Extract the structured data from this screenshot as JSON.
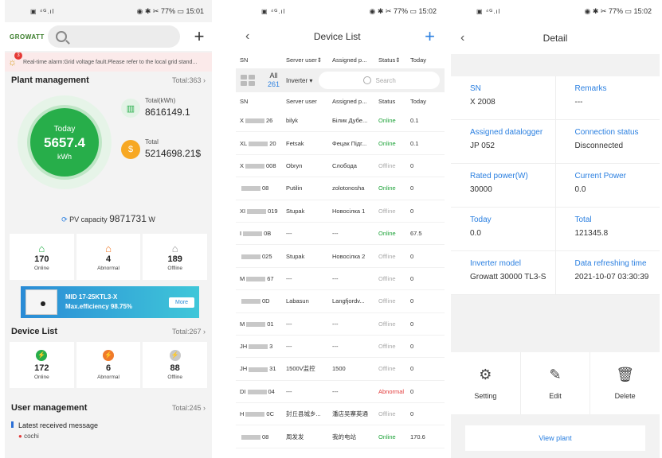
{
  "colors": {
    "accent_blue": "#2a7fe0",
    "online": "#1fa33a",
    "abnormal": "#e23b3b",
    "offline": "#aaaaaa",
    "brand_green": "#27ae4a"
  },
  "status_bar": {
    "left": {
      "icons": "▣ ⁴ᴳ.ıl"
    },
    "p1": {
      "right": "◉ ✱ ✂ 77% ▭ 15:01"
    },
    "p2": {
      "right": "◉ ✱ ✂ 77% ▭ 15:02"
    },
    "p3": {
      "right": "◉ ✱ ✂ 77% ▭ 15:02"
    }
  },
  "home": {
    "logo": "GROWATT",
    "alarm_badge": "3",
    "alarm_text": "Real-time alarm:Grid voltage fault.Please refer to the local grid stand...",
    "plant_management": {
      "title": "Plant management",
      "total": "Total:363"
    },
    "today_label": "Today",
    "today_value": "5657.4",
    "today_unit": "kWh",
    "total_kwh_label": "Total(kWh)",
    "total_kwh_value": "8616149.1",
    "total_money_label": "Total",
    "total_money_value": "5214698.21$",
    "pv_capacity_label": "PV capacity",
    "pv_capacity_value": "9871731",
    "pv_capacity_unit": "W",
    "plant_cards": [
      {
        "value": "170",
        "label": "Online"
      },
      {
        "value": "4",
        "label": "Abnormal"
      },
      {
        "value": "189",
        "label": "Offline"
      }
    ],
    "banner": {
      "line1": "MID 17-25KTL3-X",
      "line2": "Max.efficiency 98.75%",
      "button": "More"
    },
    "device_list": {
      "title": "Device List",
      "total": "Total:267"
    },
    "device_cards": [
      {
        "value": "172",
        "label": "Online"
      },
      {
        "value": "6",
        "label": "Abnormal"
      },
      {
        "value": "88",
        "label": "Offline"
      }
    ],
    "user_management": {
      "title": "User management",
      "total": "Total:245"
    },
    "latest_message": "Latest received message",
    "latest_sender": "cochi"
  },
  "device_list": {
    "title": "Device List",
    "header": [
      "SN",
      "Server user",
      "Assigned p...",
      "Status",
      "Today"
    ],
    "header_sorted": [
      "SN",
      "Server user",
      "Assigned p...",
      "Status",
      "Today"
    ],
    "filter": {
      "all_label": "All",
      "all_count": "261",
      "type": "Inverter",
      "search_placeholder": "Search"
    },
    "rows": [
      {
        "sn_a": "X",
        "sn_b": "26",
        "user": "bilyk",
        "plant": "Білик Дубе...",
        "status": "Online",
        "today": "0.1"
      },
      {
        "sn_a": "XL",
        "sn_b": "20",
        "user": "Fetsak",
        "plant": "Фецак Підг...",
        "status": "Online",
        "today": "0.1"
      },
      {
        "sn_a": "X",
        "sn_b": "008",
        "user": "Obryn",
        "plant": "Слобода",
        "status": "Offline",
        "today": "0"
      },
      {
        "sn_a": "",
        "sn_b": "08",
        "user": "Putilin",
        "plant": "zolotonosha",
        "status": "Online",
        "today": "0"
      },
      {
        "sn_a": "XI",
        "sn_b": "019",
        "user": "Stupak",
        "plant": "Новосілка 1",
        "status": "Offline",
        "today": "0"
      },
      {
        "sn_a": "I",
        "sn_b": "0B",
        "user": "---",
        "plant": "---",
        "status": "Online",
        "today": "67.5"
      },
      {
        "sn_a": "",
        "sn_b": "025",
        "user": "Stupak",
        "plant": "Новосілка 2",
        "status": "Offline",
        "today": "0"
      },
      {
        "sn_a": "M",
        "sn_b": "67",
        "user": "---",
        "plant": "---",
        "status": "Offline",
        "today": "0"
      },
      {
        "sn_a": "",
        "sn_b": "0D",
        "user": "Labasun",
        "plant": "Langfjordv...",
        "status": "Offline",
        "today": "0"
      },
      {
        "sn_a": "M",
        "sn_b": "01",
        "user": "---",
        "plant": "---",
        "status": "Offline",
        "today": "0"
      },
      {
        "sn_a": "JH",
        "sn_b": "3",
        "user": "---",
        "plant": "---",
        "status": "Offline",
        "today": "0"
      },
      {
        "sn_a": "JH",
        "sn_b": "31",
        "user": "1500V监控",
        "plant": "1500",
        "status": "Offline",
        "today": "0"
      },
      {
        "sn_a": "DI",
        "sn_b": "04",
        "user": "---",
        "plant": "---",
        "status": "Abnormal",
        "today": "0"
      },
      {
        "sn_a": "H",
        "sn_b": "0C",
        "user": "封丘县城乡...",
        "plant": "潘店吴寨英通",
        "status": "Offline",
        "today": "0"
      },
      {
        "sn_a": "",
        "sn_b": "08",
        "user": "周发发",
        "plant": "我的电站",
        "status": "Online",
        "today": "170.6"
      }
    ]
  },
  "detail": {
    "title": "Detail",
    "fields": [
      [
        {
          "k": "SN",
          "v": "X 2008"
        },
        {
          "k": "Remarks",
          "v": "---"
        }
      ],
      [
        {
          "k": "Assigned datalogger",
          "v": "JP 052"
        },
        {
          "k": "Connection status",
          "v": "Disconnected"
        }
      ],
      [
        {
          "k": "Rated power(W)",
          "v": "30000"
        },
        {
          "k": "Current Power",
          "v": "0.0"
        }
      ],
      [
        {
          "k": "Today",
          "v": "0.0"
        },
        {
          "k": "Total",
          "v": "121345.8"
        }
      ],
      [
        {
          "k": "Inverter model",
          "v": "Growatt  30000 TL3-S"
        },
        {
          "k": "Data refreshing time",
          "v": "2021-10-07 03:30:39"
        }
      ]
    ],
    "actions": [
      {
        "label": "Setting",
        "icon": "gear-icon"
      },
      {
        "label": "Edit",
        "icon": "edit-icon"
      },
      {
        "label": "Delete",
        "icon": "trash-icon"
      }
    ],
    "view_plant": "View plant"
  }
}
